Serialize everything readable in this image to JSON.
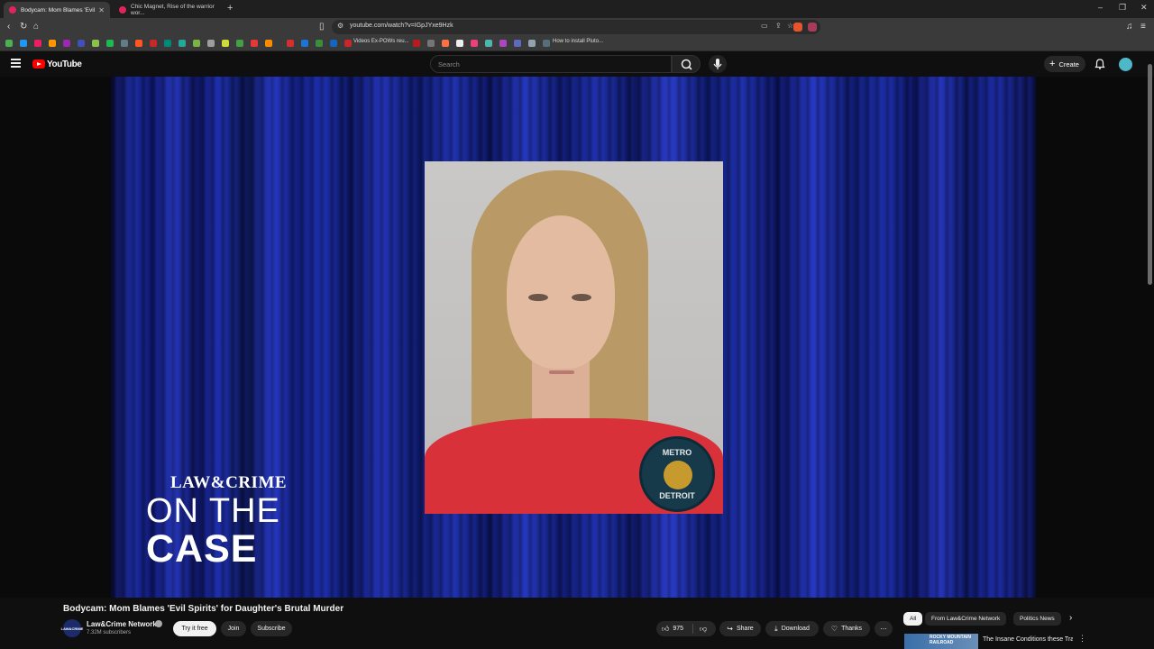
{
  "browser": {
    "tabs": [
      {
        "title": "Bodycam: Mom Blames 'Evil",
        "active": true
      },
      {
        "title": "Chic Magnet, Rise of the warrior wor...",
        "active": false
      }
    ],
    "url": "youtube.com/watch?v=IGpJYxe9Hzk",
    "bookmarks": {
      "item1": "Videos Ex-POWs reu...",
      "item2": "How to install Pluto..."
    }
  },
  "header": {
    "logo_text": "YouTube",
    "search_placeholder": "Search",
    "create_label": "Create"
  },
  "video": {
    "overlay_brand_small": "LAW&CRIME",
    "overlay_brand_mid": "ON THE",
    "overlay_brand_big": "CASE",
    "seal_top": "METRO",
    "seal_bottom": "DETROIT"
  },
  "info": {
    "title": "Bodycam: Mom Blames 'Evil Spirits' for Daughter's Brutal Murder",
    "channel_name": "Law&Crime Network",
    "channel_avatar_text": "LAW&CRIME",
    "subscribers": "7.32M subscribers",
    "try_it_label": "Try it free",
    "join_label": "Join",
    "subscribe_label": "Subscribe",
    "likes": "975",
    "share_label": "Share",
    "download_label": "Download",
    "thanks_label": "Thanks",
    "more_label": "⋯"
  },
  "sidebar": {
    "chips": [
      "All",
      "From Law&Crime Network",
      "Politics News"
    ],
    "rec_thumb_text": "ROCKY MOUNTAIN RAILROAD",
    "rec_title": "The Insane Conditions these Train Crews Face | Rocky..."
  },
  "colors": {
    "youtube_red": "#ff0000",
    "page_bg": "#0f0f0f",
    "shirt_red": "#d8313a"
  }
}
